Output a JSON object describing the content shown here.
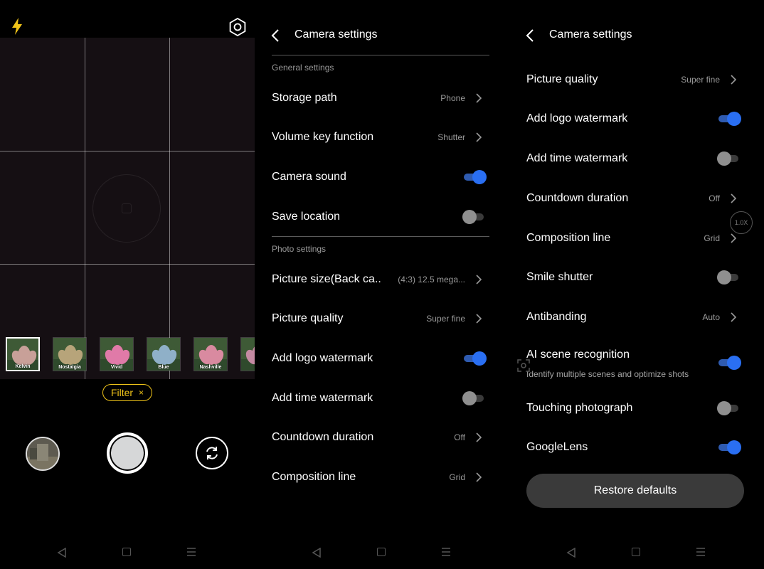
{
  "camera": {
    "filters": [
      {
        "label": "Kelvin",
        "tint": "#c8a098",
        "selected": true
      },
      {
        "label": "Nostalgia",
        "tint": "#b7a47a",
        "selected": false
      },
      {
        "label": "Vivid",
        "tint": "#e07aa8",
        "selected": false
      },
      {
        "label": "Blue",
        "tint": "#8fb0c8",
        "selected": false
      },
      {
        "label": "Nashville",
        "tint": "#d98aa0",
        "selected": false
      },
      {
        "label": "W",
        "tint": "#c48aa2",
        "selected": false
      }
    ],
    "filter_chip_label": "Filter",
    "filter_chip_close": "×"
  },
  "settings_page_1": {
    "title": "Camera settings",
    "general_section": "General settings",
    "storage_path": {
      "label": "Storage path",
      "value": "Phone"
    },
    "volume_key": {
      "label": "Volume key function",
      "value": "Shutter"
    },
    "camera_sound": {
      "label": "Camera sound",
      "on": true
    },
    "save_location": {
      "label": "Save location",
      "on": false
    },
    "photo_section": "Photo settings",
    "picture_size": {
      "label": "Picture size(Back ca..",
      "value": "(4:3) 12.5 mega..."
    },
    "picture_quality": {
      "label": "Picture quality",
      "value": "Super fine"
    },
    "logo_watermark": {
      "label": "Add logo watermark",
      "on": true
    },
    "time_watermark": {
      "label": "Add time watermark",
      "on": false
    },
    "countdown": {
      "label": "Countdown duration",
      "value": "Off"
    },
    "composition": {
      "label": "Composition line",
      "value": "Grid"
    }
  },
  "settings_page_2": {
    "title": "Camera settings",
    "picture_quality": {
      "label": "Picture quality",
      "value": "Super fine"
    },
    "logo_watermark": {
      "label": "Add logo watermark",
      "on": true
    },
    "time_watermark": {
      "label": "Add time watermark",
      "on": false
    },
    "countdown": {
      "label": "Countdown duration",
      "value": "Off"
    },
    "composition": {
      "label": "Composition line",
      "value": "Grid"
    },
    "smile_shutter": {
      "label": "Smile shutter",
      "on": false
    },
    "antibanding": {
      "label": "Antibanding",
      "value": "Auto"
    },
    "ai_scene": {
      "label": "AI scene recognition",
      "sub": "Identify multiple scenes and optimize shots",
      "on": true
    },
    "touching_photo": {
      "label": "Touching photograph",
      "on": false
    },
    "google_lens": {
      "label": "GoogleLens",
      "on": true
    },
    "restore_label": "Restore defaults",
    "zoom_label": "1.0X"
  },
  "colors": {
    "accent_blue": "#2a6ff2",
    "filter_yellow": "#f0c419"
  }
}
